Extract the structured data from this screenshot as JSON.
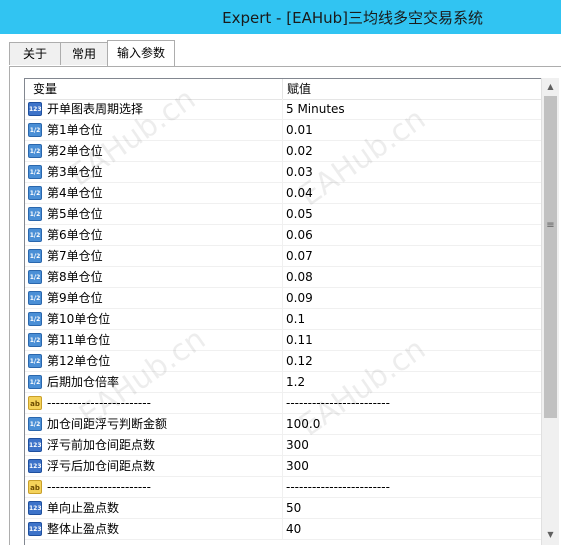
{
  "window": {
    "title": "Expert - [EAHub]三均线多空交易系统"
  },
  "tabs": [
    {
      "label": "关于",
      "active": false
    },
    {
      "label": "常用",
      "active": false
    },
    {
      "label": "输入参数",
      "active": true
    }
  ],
  "grid": {
    "headers": {
      "variable": "变量",
      "value": "赋值"
    },
    "rows": [
      {
        "type": "int",
        "icon_label": "123",
        "name": "开单图表周期选择",
        "value": "5 Minutes"
      },
      {
        "type": "dbl",
        "icon_label": "1/2",
        "name": "第1单仓位",
        "value": "0.01"
      },
      {
        "type": "dbl",
        "icon_label": "1/2",
        "name": "第2单仓位",
        "value": "0.02"
      },
      {
        "type": "dbl",
        "icon_label": "1/2",
        "name": "第3单仓位",
        "value": "0.03"
      },
      {
        "type": "dbl",
        "icon_label": "1/2",
        "name": "第4单仓位",
        "value": "0.04"
      },
      {
        "type": "dbl",
        "icon_label": "1/2",
        "name": "第5单仓位",
        "value": "0.05"
      },
      {
        "type": "dbl",
        "icon_label": "1/2",
        "name": "第6单仓位",
        "value": "0.06"
      },
      {
        "type": "dbl",
        "icon_label": "1/2",
        "name": "第7单仓位",
        "value": "0.07"
      },
      {
        "type": "dbl",
        "icon_label": "1/2",
        "name": "第8单仓位",
        "value": "0.08"
      },
      {
        "type": "dbl",
        "icon_label": "1/2",
        "name": "第9单仓位",
        "value": "0.09"
      },
      {
        "type": "dbl",
        "icon_label": "1/2",
        "name": "第10单仓位",
        "value": "0.1"
      },
      {
        "type": "dbl",
        "icon_label": "1/2",
        "name": "第11单仓位",
        "value": "0.11"
      },
      {
        "type": "dbl",
        "icon_label": "1/2",
        "name": "第12单仓位",
        "value": "0.12"
      },
      {
        "type": "dbl",
        "icon_label": "1/2",
        "name": "后期加仓倍率",
        "value": "1.2"
      },
      {
        "type": "str",
        "icon_label": "ab",
        "name": "------------------------",
        "value": "------------------------"
      },
      {
        "type": "dbl",
        "icon_label": "1/2",
        "name": "加仓间距浮亏判断金额",
        "value": "100.0"
      },
      {
        "type": "int",
        "icon_label": "123",
        "name": "浮亏前加仓间距点数",
        "value": "300"
      },
      {
        "type": "int",
        "icon_label": "123",
        "name": "浮亏后加仓间距点数",
        "value": "300"
      },
      {
        "type": "str",
        "icon_label": "ab",
        "name": "------------------------",
        "value": "------------------------"
      },
      {
        "type": "int",
        "icon_label": "123",
        "name": "单向止盈点数",
        "value": "50"
      },
      {
        "type": "int",
        "icon_label": "123",
        "name": "整体止盈点数",
        "value": "40"
      }
    ]
  },
  "watermark": "EAHub.cn",
  "colors": {
    "titlebar": "#31c4f2",
    "int_icon": "#3d73c9",
    "dbl_icon": "#4a8fd6",
    "str_icon": "#f4d25a"
  }
}
